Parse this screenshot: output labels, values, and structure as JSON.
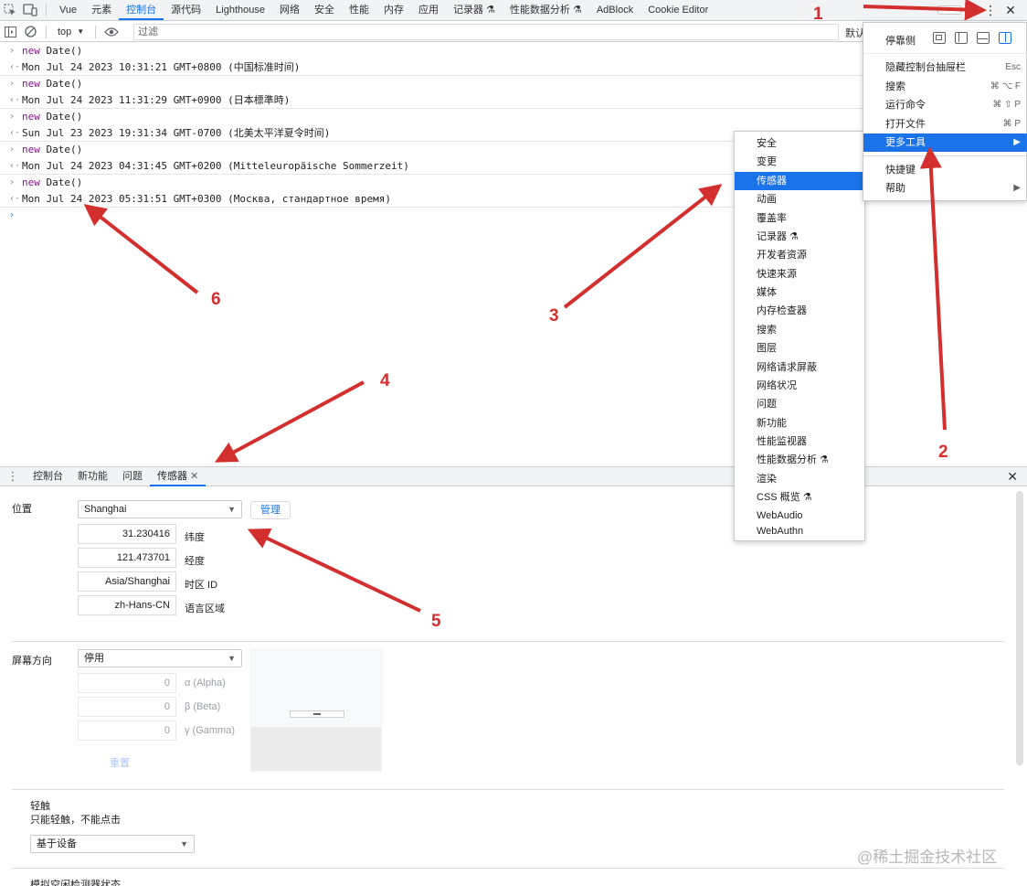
{
  "top_tabs": [
    "Vue",
    "元素",
    "控制台",
    "源代码",
    "Lighthouse",
    "网络",
    "安全",
    "性能",
    "内存",
    "应用",
    "记录器 ⚗",
    "性能数据分析 ⚗",
    "AdBlock",
    "Cookie Editor"
  ],
  "active_top_tab": "控制台",
  "console_toolbar": {
    "context": "top",
    "filter_placeholder": "过滤",
    "levels": "默认"
  },
  "console_lines": [
    {
      "type": "in",
      "keyword": "new",
      "fn": "Date()"
    },
    {
      "type": "out",
      "text": "Mon Jul 24 2023 10:31:21 GMT+0800 (中国标准时间)"
    },
    {
      "type": "in",
      "keyword": "new",
      "fn": "Date()"
    },
    {
      "type": "out",
      "text": "Mon Jul 24 2023 11:31:29 GMT+0900 (日本標準時)"
    },
    {
      "type": "in",
      "keyword": "new",
      "fn": "Date()"
    },
    {
      "type": "out",
      "text": "Sun Jul 23 2023 19:31:34 GMT-0700 (北美太平洋夏令时间)"
    },
    {
      "type": "in",
      "keyword": "new",
      "fn": "Date()"
    },
    {
      "type": "out",
      "text": "Mon Jul 24 2023 04:31:45 GMT+0200 (Mitteleuropäische Sommerzeit)"
    },
    {
      "type": "in",
      "keyword": "new",
      "fn": "Date()"
    },
    {
      "type": "out",
      "text": "Mon Jul 24 2023 05:31:51 GMT+0300 (Москва, стандартное время)"
    }
  ],
  "drawer_tabs": [
    "控制台",
    "新功能",
    "问题",
    "传感器"
  ],
  "active_drawer_tab": "传感器",
  "sensors": {
    "location_label": "位置",
    "location_value": "Shanghai",
    "manage_button": "管理",
    "latitude": "31.230416",
    "latitude_label": "纬度",
    "longitude": "121.473701",
    "longitude_label": "经度",
    "timezone": "Asia/Shanghai",
    "timezone_label": "时区 ID",
    "locale": "zh-Hans-CN",
    "locale_label": "语言区域",
    "orientation_label": "屏幕方向",
    "orientation_value": "停用",
    "alpha": "0",
    "alpha_label": "α (Alpha)",
    "beta": "0",
    "beta_label": "β (Beta)",
    "gamma": "0",
    "gamma_label": "γ (Gamma)",
    "reset": "重置",
    "touch_title": "轻触",
    "touch_desc": "只能轻触，不能点击",
    "touch_value": "基于设备",
    "idle_title": "模拟空闲检测器状态"
  },
  "main_menu": {
    "dock_label": "停靠侧",
    "items": [
      {
        "label": "隐藏控制台抽屉栏",
        "shortcut": "Esc"
      },
      {
        "label": "搜索",
        "shortcut": "⌘ ⌥ F"
      },
      {
        "label": "运行命令",
        "shortcut": "⌘ ⇧ P"
      },
      {
        "label": "打开文件",
        "shortcut": "⌘ P"
      },
      {
        "label": "更多工具",
        "shortcut": "▶"
      },
      {
        "label": "快捷键",
        "shortcut": ""
      },
      {
        "label": "帮助",
        "shortcut": "▶"
      }
    ]
  },
  "more_tools_menu": [
    "安全",
    "变更",
    "传感器",
    "动画",
    "覆盖率",
    "记录器 ⚗",
    "开发者资源",
    "快速来源",
    "媒体",
    "内存检查器",
    "搜索",
    "图层",
    "网络请求屏蔽",
    "网络状况",
    "问题",
    "新功能",
    "性能监视器",
    "性能数据分析 ⚗",
    "渲染",
    "CSS 概览 ⚗",
    "WebAudio",
    "WebAuthn"
  ],
  "annotations": [
    "1",
    "2",
    "3",
    "4",
    "5",
    "6"
  ],
  "watermark": "@稀土掘金技术社区",
  "colors": {
    "accent": "#1a73e8",
    "annotation": "#d32f2f"
  }
}
